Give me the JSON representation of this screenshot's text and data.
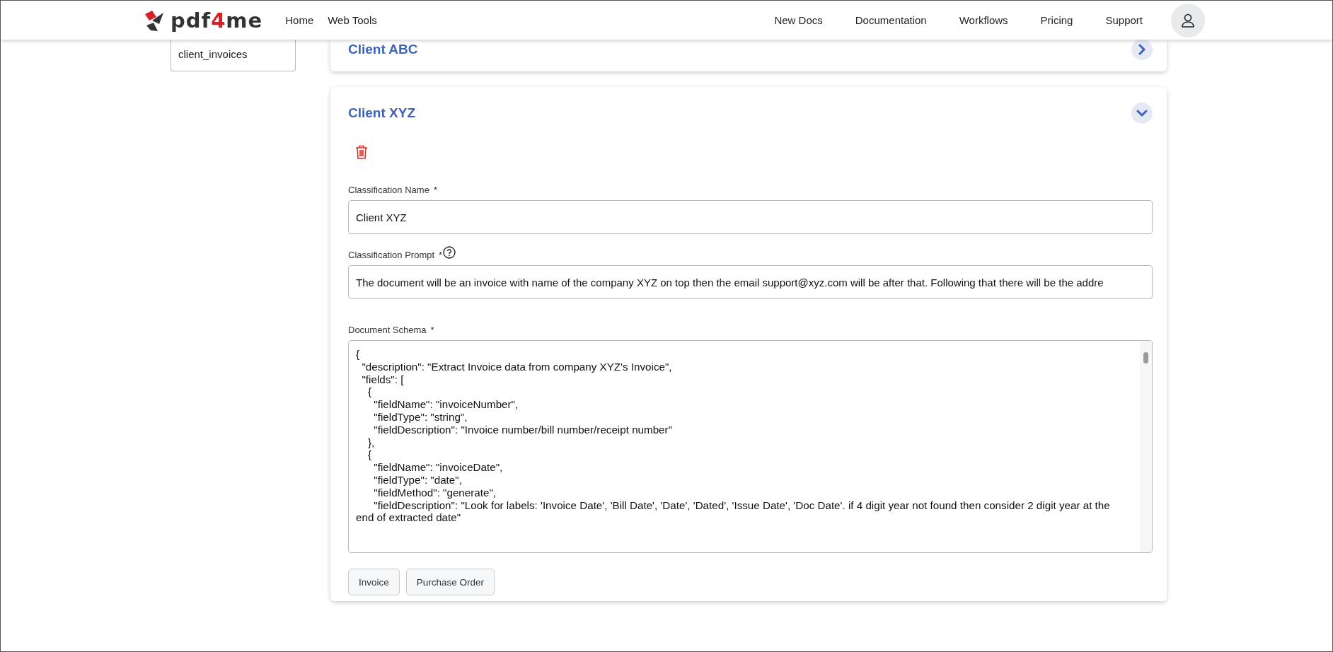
{
  "header": {
    "logo": {
      "text_start": "pdf",
      "text_mid": "4",
      "text_end": "me"
    },
    "nav_left": [
      "Home",
      "Web Tools"
    ],
    "nav_right": [
      "New Docs",
      "Documentation",
      "Workflows",
      "Pricing",
      "Support"
    ]
  },
  "sidebar": {
    "items": [
      {
        "label": "client_invoices"
      }
    ]
  },
  "cards": [
    {
      "title": "Client ABC",
      "expanded": false
    },
    {
      "title": "Client XYZ",
      "expanded": true,
      "fields": [
        {
          "kind": "text",
          "label": "Classification Name",
          "required_mark": "*",
          "help": false,
          "value": "Client XYZ"
        },
        {
          "kind": "text",
          "label": "Classification Prompt",
          "required_mark": "*",
          "help": true,
          "value": "The document will be an invoice with name of the company XYZ on top then the email support@xyz.com will be after that. Following that there will be the addre"
        },
        {
          "kind": "textarea",
          "label": "Document Schema",
          "required_mark": "*",
          "help": false,
          "value": "{\n  \"description\": \"Extract Invoice data from company XYZ's Invoice\",\n  \"fields\": [\n    {\n      \"fieldName\": \"invoiceNumber\",\n      \"fieldType\": \"string\",\n      \"fieldDescription\": \"Invoice number/bill number/receipt number\"\n    },\n    {\n      \"fieldName\": \"invoiceDate\",\n      \"fieldType\": \"date\",\n      \"fieldMethod\": \"generate\",\n      \"fieldDescription\": \"Look for labels: 'Invoice Date', 'Bill Date', 'Date', 'Dated', 'Issue Date', 'Doc Date'. if 4 digit year not found then consider 2 digit year at the end of extracted date\""
        }
      ],
      "buttons": [
        "Invoice",
        "Purchase Order"
      ]
    }
  ]
}
